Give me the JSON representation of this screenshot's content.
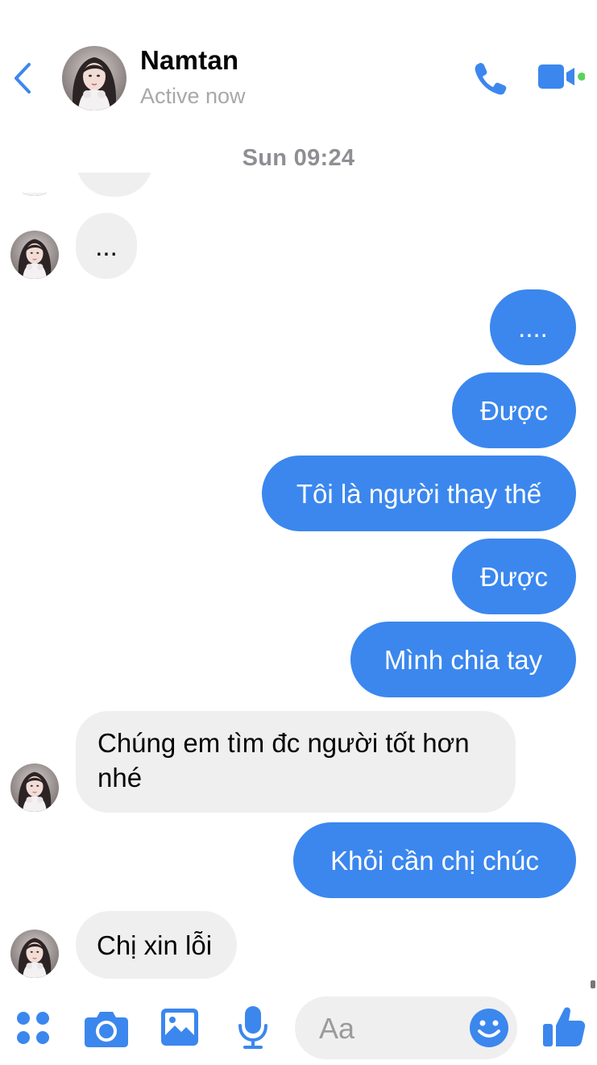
{
  "header": {
    "name": "Namtan",
    "status": "Active now"
  },
  "chat": {
    "timestamp": "Sun 09:24",
    "messages": [
      {
        "side": "in",
        "text": ""
      },
      {
        "side": "in",
        "text": "..."
      },
      {
        "side": "out",
        "text": "...."
      },
      {
        "side": "out",
        "text": "Được"
      },
      {
        "side": "out",
        "text": "Tôi là người thay thế"
      },
      {
        "side": "out",
        "text": "Được"
      },
      {
        "side": "out",
        "text": "Mình chia tay"
      },
      {
        "side": "in",
        "text": "Chúng em tìm đc người tốt hơn nhé"
      },
      {
        "side": "out",
        "text": "Khỏi cần chị chúc"
      },
      {
        "side": "in",
        "text": "Chị xin lỗi"
      }
    ]
  },
  "composer": {
    "placeholder": "Aa"
  },
  "icons": {
    "back": "chevron-left-icon",
    "call": "phone-icon",
    "video": "video-camera-icon",
    "apps": "four-dots-icon",
    "camera": "camera-icon",
    "gallery": "image-icon",
    "mic": "microphone-icon",
    "emoji": "smiley-icon",
    "like": "thumbs-up-icon"
  },
  "colors": {
    "accent": "#3b87ee",
    "incoming_bubble": "#efefef",
    "online_dot": "#5ad25a"
  }
}
